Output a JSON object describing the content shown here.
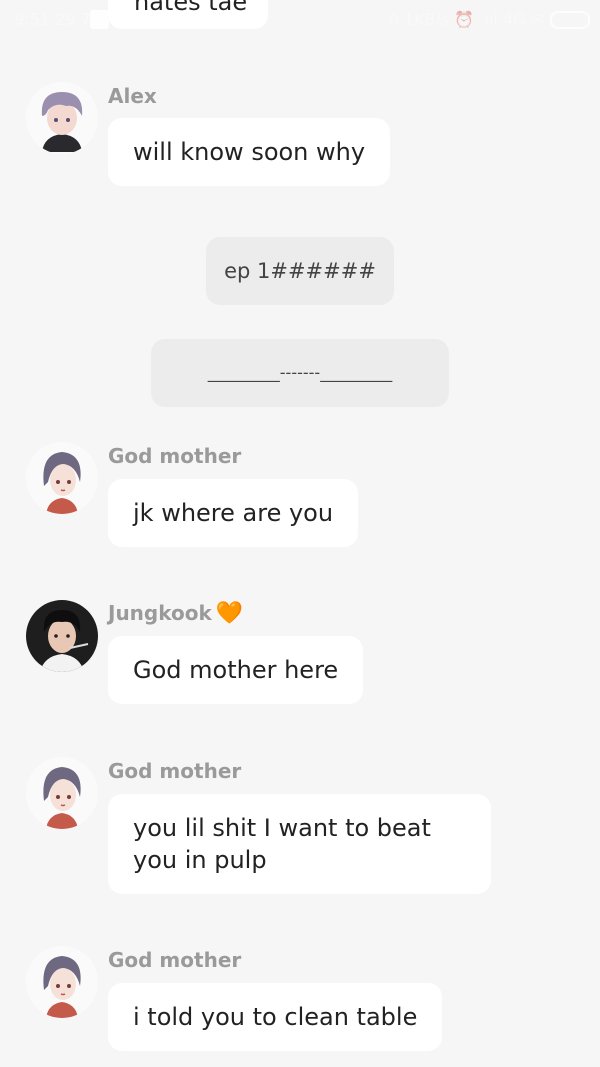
{
  "status_bar": {
    "time": "9:51 29.71",
    "right_info": "0.1KB/s ⏰ .ııl 4G ✉",
    "battery": "48"
  },
  "partial_message": {
    "text": "hates tae"
  },
  "messages": [
    {
      "sender": "Alex",
      "text": "will know soon why",
      "avatar": "alex-avatar"
    },
    {
      "sender": "God mother",
      "text": "jk where are you",
      "avatar": "god-mother-avatar"
    },
    {
      "sender": "Jungkook",
      "heart": "🧡",
      "text": "God mother here",
      "avatar": "jungkook-avatar"
    },
    {
      "sender": "God mother",
      "text": "you lil shit I want to beat you in pulp",
      "avatar": "god-mother-avatar"
    },
    {
      "sender": "God mother",
      "text": "i told you to clean table",
      "avatar": "god-mother-avatar"
    }
  ],
  "system_messages": [
    {
      "text": "ep 1######"
    },
    {
      "text": "_________-------_________"
    }
  ],
  "colors": {
    "background": "#f6f6f6",
    "bubble": "#ffffff",
    "system_bubble": "#ececec",
    "sender": "#9a9a9a",
    "heart": "#f9b21a"
  }
}
